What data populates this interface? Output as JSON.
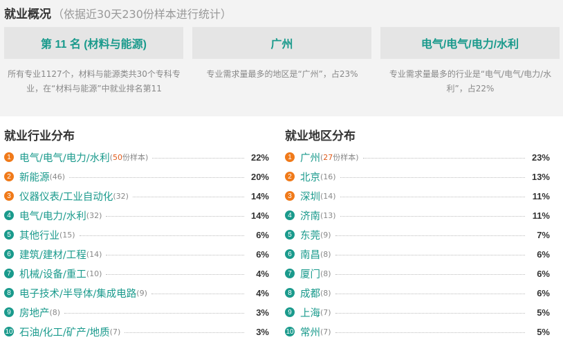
{
  "header": {
    "title": "就业概况",
    "subtitle": "（依据近30天230份样本进行统计）"
  },
  "summary": [
    {
      "headline": "第 11 名 (材料与能源)",
      "description": "所有专业1127个，材料与能源类共30个专科专业，在“材料与能源”中就业排名第11"
    },
    {
      "headline": "广州",
      "description": "专业需求量最多的地区是“广州”，占23%"
    },
    {
      "headline": "电气/电气/电力/水利",
      "description": "专业需求量最多的行业是“电气/电气/电力/水利”，占22%"
    }
  ],
  "industry": {
    "title": "就业行业分布",
    "sample_suffix": "份样本",
    "items": [
      {
        "rank": "1",
        "name": "电气/电气/电力/水利",
        "count": "50",
        "percent": "22%"
      },
      {
        "rank": "2",
        "name": "新能源",
        "count": "(46)",
        "percent": "20%"
      },
      {
        "rank": "3",
        "name": "仪器仪表/工业自动化",
        "count": "(32)",
        "percent": "14%"
      },
      {
        "rank": "4",
        "name": "电气/电力/水利",
        "count": "(32)",
        "percent": "14%"
      },
      {
        "rank": "5",
        "name": "其他行业",
        "count": "(15)",
        "percent": "6%"
      },
      {
        "rank": "6",
        "name": "建筑/建材/工程",
        "count": "(14)",
        "percent": "6%"
      },
      {
        "rank": "7",
        "name": "机械/设备/重工",
        "count": "(10)",
        "percent": "4%"
      },
      {
        "rank": "8",
        "name": "电子技术/半导体/集成电路",
        "count": "(9)",
        "percent": "4%"
      },
      {
        "rank": "9",
        "name": "房地产",
        "count": "(8)",
        "percent": "3%"
      },
      {
        "rank": "10",
        "name": "石油/化工/矿产/地质",
        "count": "(7)",
        "percent": "3%"
      }
    ]
  },
  "region": {
    "title": "就业地区分布",
    "sample_suffix": "份样本",
    "items": [
      {
        "rank": "1",
        "name": "广州",
        "count": "27",
        "percent": "23%"
      },
      {
        "rank": "2",
        "name": "北京",
        "count": "(16)",
        "percent": "13%"
      },
      {
        "rank": "3",
        "name": "深圳",
        "count": "(14)",
        "percent": "11%"
      },
      {
        "rank": "4",
        "name": "济南",
        "count": "(13)",
        "percent": "11%"
      },
      {
        "rank": "5",
        "name": "东莞",
        "count": "(9)",
        "percent": "7%"
      },
      {
        "rank": "6",
        "name": "南昌",
        "count": "(8)",
        "percent": "6%"
      },
      {
        "rank": "7",
        "name": "厦门",
        "count": "(8)",
        "percent": "6%"
      },
      {
        "rank": "8",
        "name": "成都",
        "count": "(8)",
        "percent": "6%"
      },
      {
        "rank": "9",
        "name": "上海",
        "count": "(7)",
        "percent": "5%"
      },
      {
        "rank": "10",
        "name": "常州",
        "count": "(7)",
        "percent": "5%"
      }
    ]
  },
  "colors": {
    "accent_teal": "#1a9a8c",
    "accent_orange": "#f07a1a",
    "sample_count_red": "#e05a1a"
  }
}
